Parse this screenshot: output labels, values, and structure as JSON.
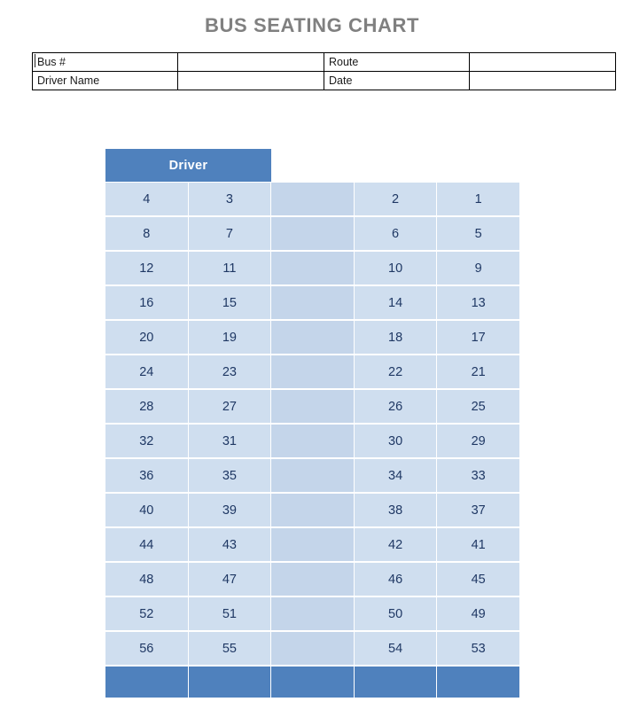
{
  "page": {
    "title": "BUS SEATING CHART"
  },
  "info_table": {
    "rows": [
      {
        "label": "Bus #",
        "value": "",
        "label2": "Route",
        "value2": ""
      },
      {
        "label": "Driver Name",
        "value": "",
        "label2": "Date",
        "value2": ""
      }
    ]
  },
  "seat_chart": {
    "driver_label": "Driver",
    "aisle_label": "",
    "colors": {
      "seat_fill": "#cfdeef",
      "aisle_fill": "#c4d5ea",
      "header_blue": "#4f81bd",
      "seat_text": "#1f3864",
      "title_gray": "#808080"
    },
    "columns": 5,
    "aisle_column_index": 2,
    "total_seats": 56,
    "rows": [
      [
        "4",
        "3",
        "",
        "2",
        "1"
      ],
      [
        "8",
        "7",
        "",
        "6",
        "5"
      ],
      [
        "12",
        "11",
        "",
        "10",
        "9"
      ],
      [
        "16",
        "15",
        "",
        "14",
        "13"
      ],
      [
        "20",
        "19",
        "",
        "18",
        "17"
      ],
      [
        "24",
        "23",
        "",
        "22",
        "21"
      ],
      [
        "28",
        "27",
        "",
        "26",
        "25"
      ],
      [
        "32",
        "31",
        "",
        "30",
        "29"
      ],
      [
        "36",
        "35",
        "",
        "34",
        "33"
      ],
      [
        "40",
        "39",
        "",
        "38",
        "37"
      ],
      [
        "44",
        "43",
        "",
        "42",
        "41"
      ],
      [
        "48",
        "47",
        "",
        "46",
        "45"
      ],
      [
        "52",
        "51",
        "",
        "50",
        "49"
      ],
      [
        "56",
        "55",
        "",
        "54",
        "53"
      ]
    ],
    "footer_row": [
      "",
      "",
      "",
      "",
      ""
    ]
  }
}
